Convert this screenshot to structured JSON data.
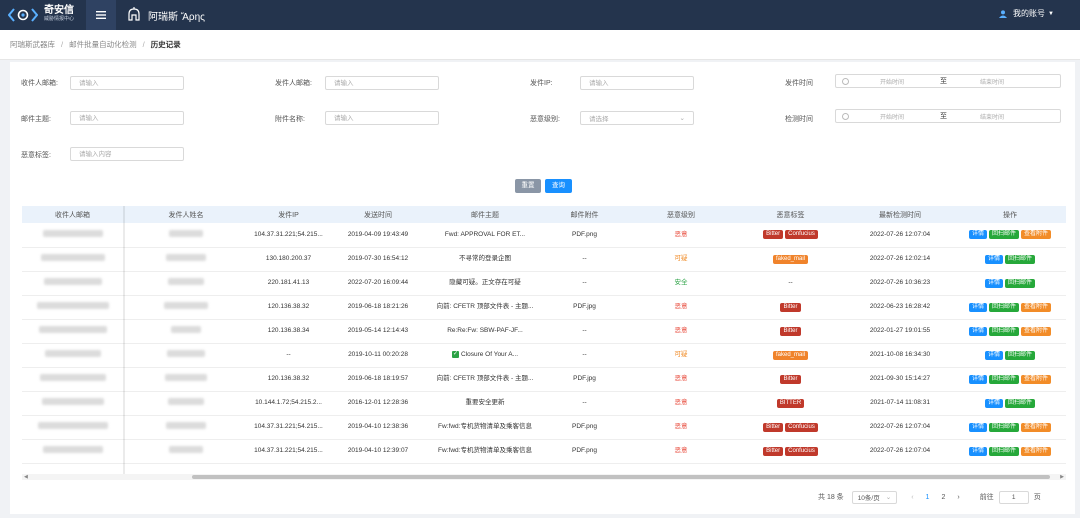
{
  "brand": {
    "name": "奇安信",
    "sub": "威胁情报中心",
    "product": "阿瑞斯 Ἄρης"
  },
  "account": {
    "label": "我的账号"
  },
  "breadcrumb": [
    "阿瑞斯武器库",
    "邮件批量自动化检测",
    "历史记录"
  ],
  "filters": {
    "recipient": {
      "label": "收件人邮箱:",
      "placeholder": "请输入"
    },
    "sender": {
      "label": "发件人邮箱:",
      "placeholder": "请输入"
    },
    "ip": {
      "label": "发件IP:",
      "placeholder": "请输入"
    },
    "send_time": {
      "label": "发件时间",
      "start": "开始时间",
      "sep": "至",
      "end": "结束时间"
    },
    "subject": {
      "label": "邮件主题:",
      "placeholder": "请输入"
    },
    "attachment": {
      "label": "附件名称:",
      "placeholder": "请输入"
    },
    "level": {
      "label": "恶意级别:",
      "placeholder": "请选择"
    },
    "detect_time": {
      "label": "检测时间",
      "start": "开始时间",
      "sep": "至",
      "end": "结束时间"
    },
    "tag": {
      "label": "恶意标签:",
      "placeholder": "请输入内容"
    }
  },
  "buttons": {
    "reset": "重置",
    "query": "查询"
  },
  "table": {
    "headers": [
      "收件人邮箱",
      "发件人姓名",
      "发件IP",
      "发送时间",
      "邮件主题",
      "邮件附件",
      "恶意级别",
      "恶意标签",
      "最新检测时间",
      "操作"
    ],
    "ops": {
      "detail": "详情",
      "scan": "回扫邮件",
      "attach": "查看附件"
    },
    "rows": [
      {
        "ip": "104.37.31.221;54.215...",
        "time": "2019-04-09 19:43:49",
        "subject": "Fwd: APPROVAL FOR ET...",
        "attach": "PDF.png",
        "level": "恶意",
        "level_type": "m",
        "tags": [
          "Bitter",
          "Confucius"
        ],
        "tag_style": "r",
        "detect": "2022-07-26 12:07:04",
        "has_attach": true
      },
      {
        "ip": "130.180.200.37",
        "time": "2019-07-30 16:54:12",
        "subject": "不寻常的登录企图",
        "attach": "--",
        "level": "可疑",
        "level_type": "s",
        "tags": [
          "faked_mail"
        ],
        "tag_style": "o",
        "detect": "2022-07-26 12:02:14",
        "has_attach": false
      },
      {
        "ip": "220.181.41.13",
        "time": "2022-07-20 16:09:44",
        "subject": "隐藏可疑。正文存在可疑",
        "attach": "--",
        "level": "安全",
        "level_type": "a",
        "tags": [],
        "tag_text": "--",
        "detect": "2022-07-26 10:36:23",
        "has_attach": false
      },
      {
        "ip": "120.136.38.32",
        "time": "2019-06-18 18:21:26",
        "subject": "向前: CFETR 顶部文件表 - 主题...",
        "attach": "PDF.jpg",
        "level": "恶意",
        "level_type": "m",
        "tags": [
          "Bitter"
        ],
        "tag_style": "r",
        "detect": "2022-06-23 16:28:42",
        "has_attach": true
      },
      {
        "ip": "120.136.38.34",
        "time": "2019-05-14 12:14:43",
        "subject": "Re:Re:Fw: SBW-PAF-JF...",
        "attach": "--",
        "level": "恶意",
        "level_type": "m",
        "tags": [
          "Bitter"
        ],
        "tag_style": "r",
        "detect": "2022-01-27 19:01:55",
        "has_attach": true
      },
      {
        "ip": "--",
        "time": "2019-10-11 00:20:28",
        "subject": "Closure Of Your A...",
        "check": true,
        "attach": "--",
        "level": "可疑",
        "level_type": "s",
        "tags": [
          "faked_mail"
        ],
        "tag_style": "o",
        "detect": "2021-10-08 16:34:30",
        "has_attach": false
      },
      {
        "ip": "120.136.38.32",
        "time": "2019-06-18 18:19:57",
        "subject": "向前: CFETR 顶部文件表 - 主题...",
        "attach": "PDF.jpg",
        "level": "恶意",
        "level_type": "m",
        "tags": [
          "Bitter"
        ],
        "tag_style": "r",
        "detect": "2021-09-30 15:14:27",
        "has_attach": true
      },
      {
        "ip": "10.144.1.72;54.215.2...",
        "time": "2016-12-01 12:28:36",
        "subject": "重要安全更新",
        "attach": "--",
        "level": "恶意",
        "level_type": "m",
        "tags": [
          "BITTER"
        ],
        "tag_style": "r",
        "detect": "2021-07-14 11:08:31",
        "has_attach": false
      },
      {
        "ip": "104.37.31.221;54.215...",
        "time": "2019-04-10 12:38:36",
        "subject": "Fw:fwd:专机货物清单及乘客信息",
        "attach": "PDF.png",
        "level": "恶意",
        "level_type": "m",
        "tags": [
          "Bitter",
          "Confucius"
        ],
        "tag_style": "r",
        "detect": "2022-07-26 12:07:04",
        "has_attach": true
      },
      {
        "ip": "104.37.31.221;54.215...",
        "time": "2019-04-10 12:39:07",
        "subject": "Fw:fwd:专机货物清单及乘客信息",
        "attach": "PDF.png",
        "level": "恶意",
        "level_type": "m",
        "tags": [
          "Bitter",
          "Confucius"
        ],
        "tag_style": "r",
        "detect": "2022-07-26 12:07:04",
        "has_attach": true
      }
    ]
  },
  "pagination": {
    "total": "共 18 条",
    "size": "10条/页",
    "pages": [
      "1",
      "2"
    ],
    "current": "1",
    "goto_label": "前往",
    "goto_value": "1",
    "page_unit": "页"
  }
}
